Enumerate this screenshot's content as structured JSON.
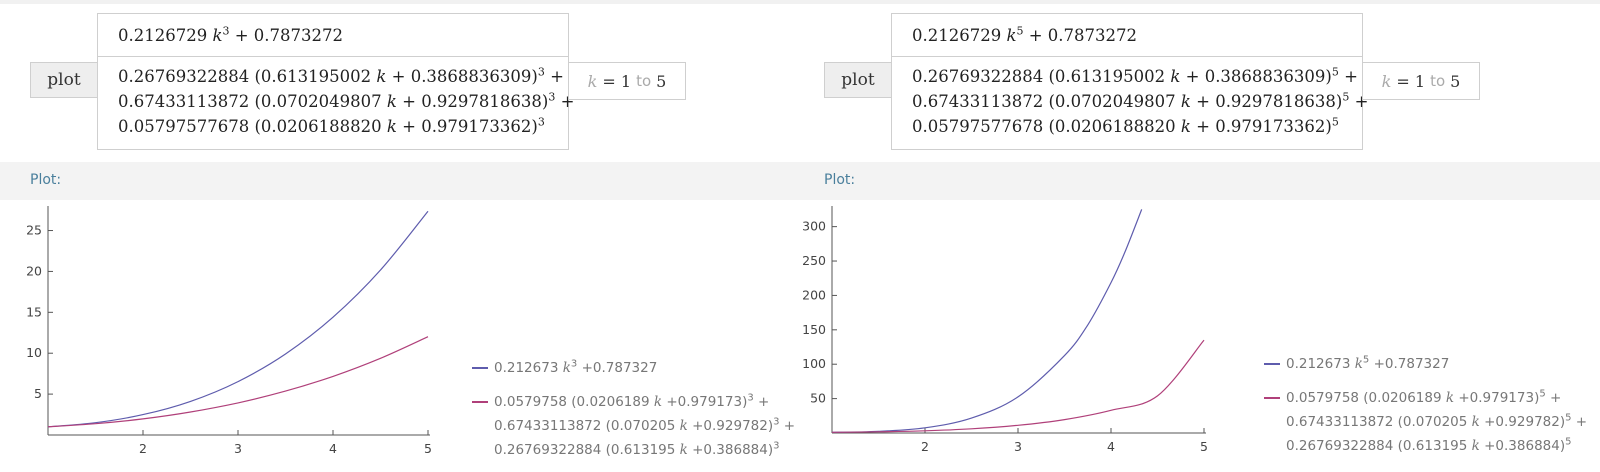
{
  "panels": [
    {
      "button_label": "plot",
      "expr1": {
        "pre": "0.2126729 ",
        "var": "k",
        "exp": "3",
        "post": " + 0.7873272"
      },
      "expr2_lines": [
        {
          "a": "0.26769322884 (0.613195002 ",
          "b": " + 0.3868836309)",
          "exp": "3",
          "tail": " +"
        },
        {
          "a": "0.67433113872 (0.0702049807 ",
          "b": " + 0.9297818638)",
          "exp": "3",
          "tail": " +"
        },
        {
          "a": "0.05797577678 (0.0206188820 ",
          "b": " + 0.979173362)",
          "exp": "3",
          "tail": ""
        }
      ],
      "range": {
        "var": "k",
        "eq": "=",
        "from": "1",
        "to_word": "to",
        "to": "5"
      },
      "plot_header": "Plot:",
      "legend": [
        {
          "lines": [
            {
              "a": "0.212673 ",
              "exp": "3",
              "b": " +0.787327"
            }
          ]
        },
        {
          "lines": [
            {
              "a": "0.0579758 (0.0206189 ",
              "b": " +0.979173)",
              "exp": "3",
              "tail": " +"
            },
            {
              "a": "0.67433113872 (0.070205 ",
              "b": " +0.929782)",
              "exp": "3",
              "tail": " +"
            },
            {
              "a": "0.26769322884 (0.613195 ",
              "b": " +0.386884)",
              "exp": "3",
              "tail": ""
            }
          ]
        }
      ]
    },
    {
      "button_label": "plot",
      "expr1": {
        "pre": "0.2126729 ",
        "var": "k",
        "exp": "5",
        "post": " + 0.7873272"
      },
      "expr2_lines": [
        {
          "a": "0.26769322884 (0.613195002 ",
          "b": " + 0.3868836309)",
          "exp": "5",
          "tail": " +"
        },
        {
          "a": "0.67433113872 (0.0702049807 ",
          "b": " + 0.9297818638)",
          "exp": "5",
          "tail": " +"
        },
        {
          "a": "0.05797577678 (0.0206188820 ",
          "b": " + 0.979173362)",
          "exp": "5",
          "tail": ""
        }
      ],
      "range": {
        "var": "k",
        "eq": "=",
        "from": "1",
        "to_word": "to",
        "to": "5"
      },
      "plot_header": "Plot:",
      "legend": [
        {
          "lines": [
            {
              "a": "0.212673 ",
              "exp": "5",
              "b": " +0.787327"
            }
          ]
        },
        {
          "lines": [
            {
              "a": "0.0579758 (0.0206189 ",
              "b": " +0.979173)",
              "exp": "5",
              "tail": " +"
            },
            {
              "a": "0.67433113872 (0.070205 ",
              "b": " +0.929782)",
              "exp": "5",
              "tail": " +"
            },
            {
              "a": "0.26769322884 (0.613195 ",
              "b": " +0.386884)",
              "exp": "5",
              "tail": ""
            }
          ]
        }
      ]
    }
  ],
  "colors": {
    "series1": "#5e5cad",
    "series2": "#b0407a",
    "axis": "#555555",
    "header_text": "#4a7f9c"
  },
  "chart_data": [
    {
      "type": "line",
      "xlim": [
        1,
        5
      ],
      "ylim": [
        0,
        28
      ],
      "xticks": [
        2,
        3,
        4,
        5
      ],
      "yticks": [
        5,
        10,
        15,
        20,
        25
      ],
      "grid": false,
      "legend_position": "right",
      "series": [
        {
          "x": [
            1,
            1.5,
            2,
            2.5,
            3,
            3.5,
            4,
            4.5,
            5
          ],
          "y": [
            1.0,
            1.5,
            2.49,
            4.11,
            6.53,
            9.91,
            14.4,
            20.17,
            27.37
          ]
        },
        {
          "x": [
            1,
            1.5,
            2,
            2.5,
            3,
            3.5,
            4,
            4.5,
            5
          ],
          "y": [
            1.0,
            1.38,
            1.97,
            2.81,
            3.93,
            5.37,
            7.17,
            9.38,
            12.02
          ]
        }
      ]
    },
    {
      "type": "line",
      "xlim": [
        1,
        5
      ],
      "ylim": [
        0,
        330
      ],
      "xticks": [
        2,
        3,
        4,
        5
      ],
      "yticks": [
        50,
        100,
        150,
        200,
        250,
        300
      ],
      "grid": false,
      "legend_position": "right",
      "series": [
        {
          "x": [
            1,
            1.5,
            2,
            2.5,
            3,
            3.5,
            3.75,
            4,
            4.15,
            4.33
          ],
          "y": [
            1.0,
            2.4,
            7.59,
            21.6,
            52.5,
            112.5,
            157.2,
            218.6,
            263.3,
            325.0
          ]
        },
        {
          "x": [
            1,
            1.5,
            2,
            2.5,
            3,
            3.5,
            4,
            4.5,
            5
          ],
          "y": [
            1.0,
            1.7,
            3.2,
            6.1,
            11.2,
            19.5,
            33.0,
            54.0,
            135.0
          ]
        }
      ]
    }
  ]
}
